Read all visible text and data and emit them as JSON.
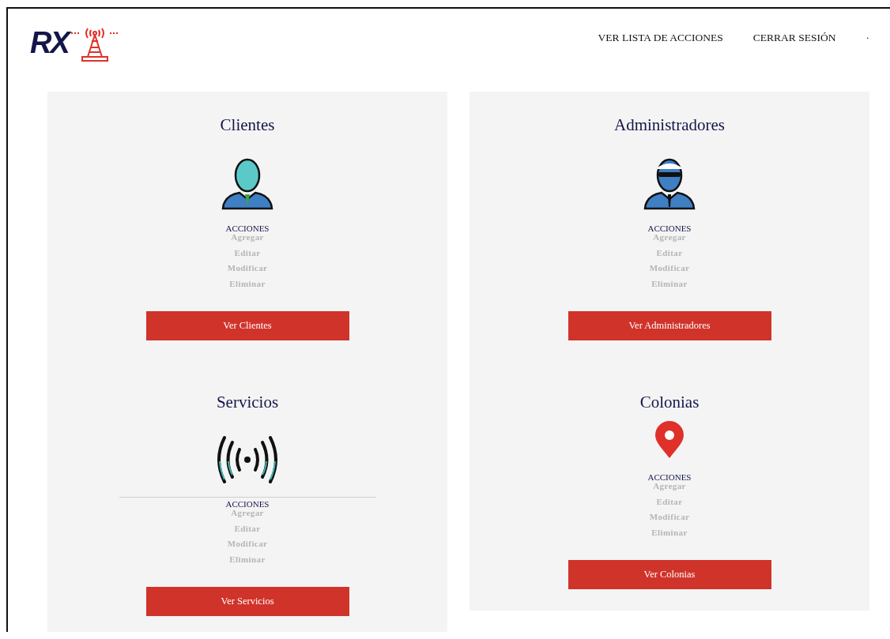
{
  "header": {
    "logo_text": "RX",
    "nav": [
      {
        "label": "VER LISTA DE ACCIONES"
      },
      {
        "label": "CERRAR SESIÓN"
      },
      {
        "label": "·"
      }
    ]
  },
  "columns": [
    {
      "sections": [
        {
          "title": "Clientes",
          "kind": "client",
          "divider": false,
          "actions_label": "ACCIONES",
          "actions": [
            "Agregar",
            "Editar",
            "Modificar",
            "Eliminar"
          ],
          "button": "Ver Clientes"
        },
        {
          "title": "Servicios",
          "kind": "signal",
          "divider": true,
          "actions_label": "ACCIONES",
          "actions": [
            "Agregar",
            "Editar",
            "Modificar",
            "Eliminar"
          ],
          "button": "Ver Servicios"
        }
      ]
    },
    {
      "sections": [
        {
          "title": "Administradores",
          "kind": "admin",
          "divider": false,
          "actions_label": "ACCIONES",
          "actions": [
            "Agregar",
            "Editar",
            "Modificar",
            "Eliminar"
          ],
          "button": "Ver Administradores"
        },
        {
          "title": "Colonias",
          "kind": "pin",
          "divider": false,
          "actions_label": "ACCIONES",
          "actions": [
            "Agregar",
            "Editar",
            "Modificar",
            "Eliminar"
          ],
          "button": "Ver Colonias"
        }
      ]
    }
  ]
}
